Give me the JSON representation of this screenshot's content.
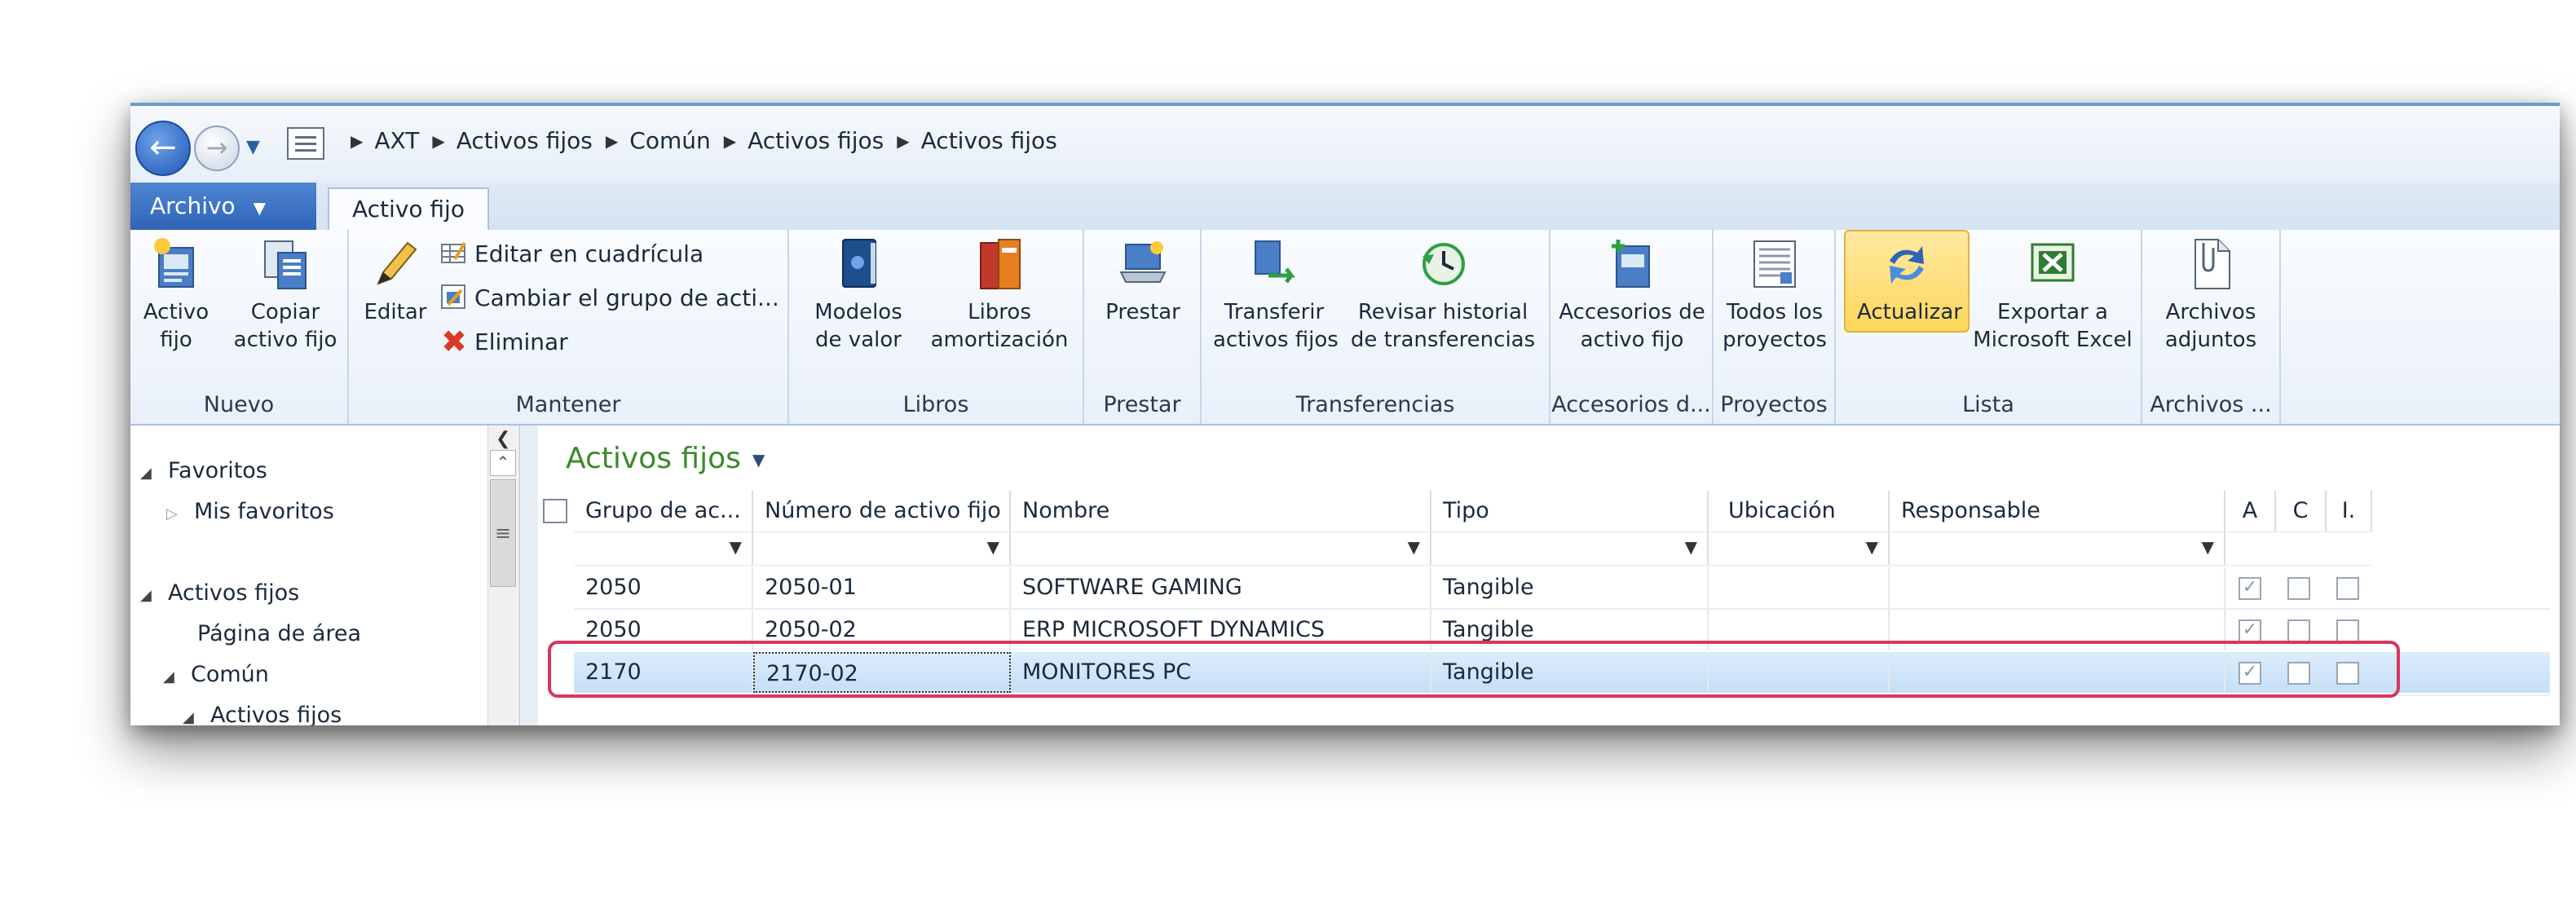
{
  "breadcrumb": [
    "AXT",
    "Activos fijos",
    "Común",
    "Activos fijos",
    "Activos fijos"
  ],
  "tabs": {
    "file": "Archivo",
    "active": "Activo fijo"
  },
  "ribbon": {
    "nuevo": {
      "label": "Nuevo",
      "activo_fijo": [
        "Activo",
        "fijo"
      ],
      "copiar": [
        "Copiar",
        "activo fijo"
      ]
    },
    "mantener": {
      "label": "Mantener",
      "editar": "Editar",
      "editar_cuadricula": "Editar en cuadrícula",
      "cambiar_grupo": "Cambiar el grupo de acti...",
      "eliminar": "Eliminar"
    },
    "libros": {
      "label": "Libros",
      "modelos": [
        "Modelos",
        "de valor"
      ],
      "libros_amort": [
        "Libros",
        "amortización"
      ]
    },
    "prestar": {
      "label": "Prestar",
      "prestar": "Prestar"
    },
    "transferencias": {
      "label": "Transferencias",
      "transferir": [
        "Transferir",
        "activos fijos"
      ],
      "revisar": [
        "Revisar historial",
        "de transferencias"
      ]
    },
    "accesorios": {
      "label": "Accesorios d...",
      "accesorios": [
        "Accesorios de",
        "activo fijo"
      ]
    },
    "proyectos": {
      "label": "Proyectos",
      "todos": [
        "Todos los",
        "proyectos"
      ]
    },
    "lista": {
      "label": "Lista",
      "actualizar": "Actualizar",
      "exportar": [
        "Exportar a",
        "Microsoft Excel"
      ]
    },
    "archivos": {
      "label": "Archivos ...",
      "adjuntos": [
        "Archivos",
        "adjuntos"
      ]
    }
  },
  "navpane": {
    "favoritos": "Favoritos",
    "mis_favoritos": "Mis favoritos",
    "activos_fijos": "Activos fijos",
    "pagina_area": "Página de área",
    "comun": "Común",
    "activos_fijos_sub": "Activos fijos"
  },
  "grid": {
    "title": "Activos fijos",
    "columns": [
      "Grupo de ac...",
      "Número de activo fijo",
      "Nombre",
      "Tipo",
      "Ubicación",
      "Responsable",
      "A",
      "C",
      "I."
    ],
    "rows": [
      {
        "grupo": "2050",
        "numero": "2050-01",
        "nombre": "SOFTWARE GAMING",
        "tipo": "Tangible",
        "ubicacion": "",
        "responsable": "",
        "a": true,
        "c": false,
        "i": false
      },
      {
        "grupo": "2050",
        "numero": "2050-02",
        "nombre": "ERP MICROSOFT DYNAMICS",
        "tipo": "Tangible",
        "ubicacion": "",
        "responsable": "",
        "a": true,
        "c": false,
        "i": false
      },
      {
        "grupo": "2170",
        "numero": "2170-02",
        "nombre": "MONITORES PC",
        "tipo": "Tangible",
        "ubicacion": "",
        "responsable": "",
        "a": true,
        "c": false,
        "i": false
      }
    ]
  },
  "colors": {
    "accent": "#2f64b7",
    "title_green": "#3b8a2a",
    "highlight": "#d6375e",
    "selected_row": "#c6dff7"
  }
}
